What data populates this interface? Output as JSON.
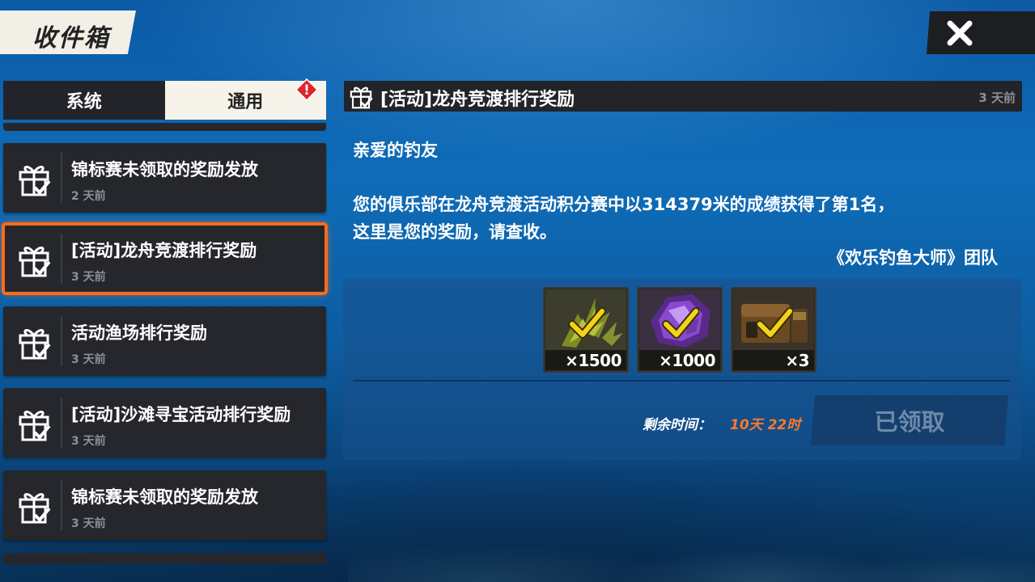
{
  "header": {
    "title": "收件箱",
    "close_icon": "close-icon"
  },
  "tabs": [
    {
      "label": "系统",
      "active": false
    },
    {
      "label": "通用",
      "active": true,
      "alert": "!"
    }
  ],
  "mail_list": [
    {
      "title": "锦标赛未领取的奖励发放",
      "time": "2 天前",
      "icon": "gift-icon",
      "selected": false
    },
    {
      "title": "[活动]龙舟竞渡排行奖励",
      "time": "3 天前",
      "icon": "gift-icon",
      "selected": true
    },
    {
      "title": "活动渔场排行奖励",
      "time": "3 天前",
      "icon": "gift-icon",
      "selected": false
    },
    {
      "title": "[活动]沙滩寻宝活动排行奖励",
      "time": "3 天前",
      "icon": "gift-icon",
      "selected": false
    },
    {
      "title": "锦标赛未领取的奖励发放",
      "time": "3 天前",
      "icon": "gift-icon",
      "selected": false
    }
  ],
  "detail": {
    "title": "[活动]龙舟竞渡排行奖励",
    "time": "3 天前",
    "greeting": "亲爱的钓友",
    "body_line1": "您的俱乐部在龙舟竞渡活动积分赛中以314379米的成绩获得了第1名，",
    "body_line2": "这里是您的奖励，请查收。",
    "signature": "《欢乐钓鱼大师》团队",
    "rewards": [
      {
        "icon": "energy-icon",
        "quantity": "×1500",
        "claimed": true
      },
      {
        "icon": "gem-icon",
        "quantity": "×1000",
        "claimed": true
      },
      {
        "icon": "chest-icon",
        "quantity": "×3",
        "claimed": true
      }
    ],
    "remaining_label": "剩余时间：",
    "remaining_value": "10天 22时",
    "claim_button": "已领取"
  },
  "colors": {
    "selected_outline": "#ff6a1a",
    "remaining_time": "#ff7a2a",
    "check_mark": "#f5d21a",
    "alert_badge": "#e0242a"
  }
}
